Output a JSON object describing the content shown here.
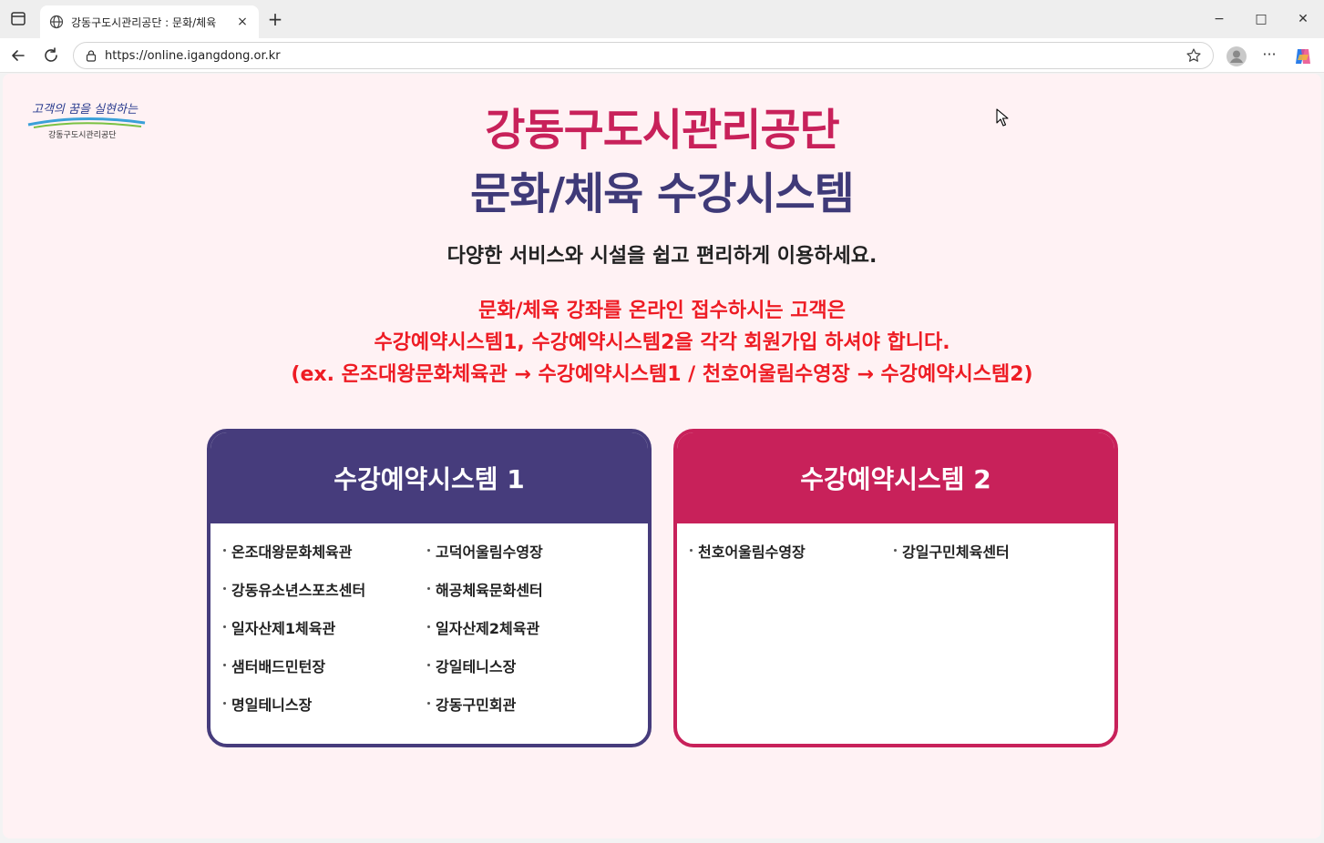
{
  "browser": {
    "tab_title": "강동구도시관리공단 : 문화/체육",
    "tab_close": "×",
    "new_tab": "+",
    "url": "https://online.igangdong.or.kr",
    "more": "···",
    "minimize": "−",
    "maximize": "□",
    "close": "✕"
  },
  "logo": {
    "line1": "고객의 꿈을 실현하는",
    "line2": "강동구도시관리공단"
  },
  "header": {
    "title1": "강동구도시관리공단",
    "title2": "문화/체육 수강시스템",
    "subtitle": "다양한 서비스와 시설을 쉽고 편리하게 이용하세요."
  },
  "notice": {
    "line1": "문화/체육 강좌를 온라인 접수하시는 고객은",
    "line2": "수강예약시스템1, 수강예약시스템2을 각각 회원가입 하셔야 합니다.",
    "line3": "(ex. 온조대왕문화체육관 → 수강예약시스템1 / 천호어울림수영장 → 수강예약시스템2)"
  },
  "system1": {
    "title": "수강예약시스템 1",
    "facilities": [
      "온조대왕문화체육관",
      "고덕어울림수영장",
      "강동유소년스포츠센터",
      "해공체육문화센터",
      "일자산제1체육관",
      "일자산제2체육관",
      "샘터배드민턴장",
      "강일테니스장",
      "명일테니스장",
      "강동구민회관"
    ]
  },
  "system2": {
    "title": "수강예약시스템 2",
    "facilities": [
      "천호어울림수영장",
      "강일구민체육센터"
    ]
  },
  "colors": {
    "primary_pink": "#c8215a",
    "primary_navy": "#463c7c",
    "notice_red": "#ee1c24",
    "page_bg": "#fff2f4"
  },
  "icons": [
    "tab-strip-icon",
    "globe-icon",
    "back-icon",
    "refresh-icon",
    "lock-icon",
    "star-icon",
    "profile-icon",
    "more-icon",
    "copilot-icon",
    "cursor-icon"
  ]
}
